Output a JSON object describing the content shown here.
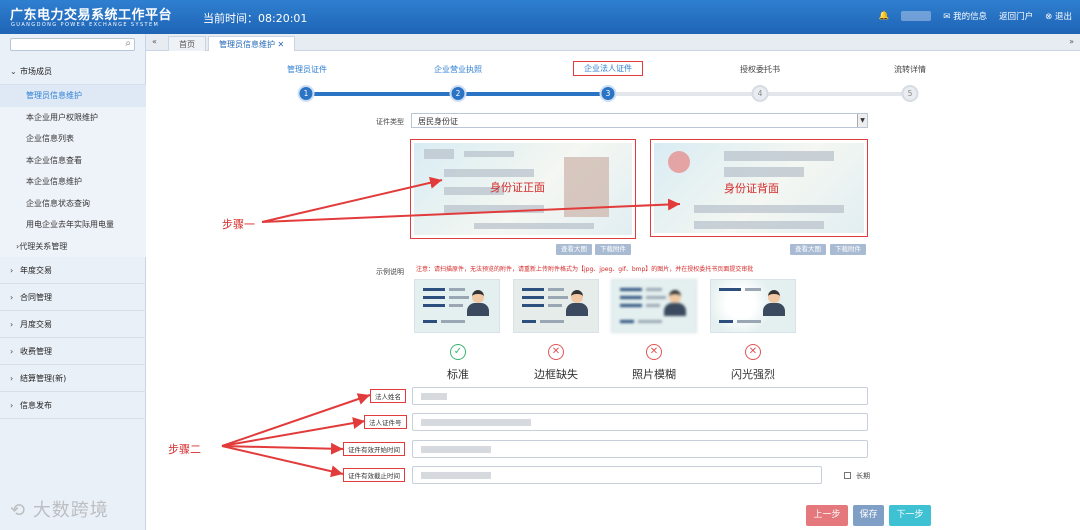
{
  "header": {
    "title_cn": "广东电力交易系统工作平台",
    "title_en": "GUANGDONG POWER EXCHANGE SYSTEM",
    "clock": "当前时间：08:20:01",
    "my_info": "我的信息",
    "return_portal": "返回门户",
    "logout": "退出"
  },
  "tabs": [
    {
      "label": "首页"
    },
    {
      "label": "管理员信息维护"
    }
  ],
  "sidebar": {
    "groups": [
      {
        "label": "市场成员"
      },
      {
        "label": "年度交易"
      },
      {
        "label": "合同管理"
      },
      {
        "label": "月度交易"
      },
      {
        "label": "收费管理"
      },
      {
        "label": "结算管理(新)"
      },
      {
        "label": "信息发布"
      }
    ],
    "subitems": [
      {
        "label": "管理员信息维护"
      },
      {
        "label": "本企业用户权限维护"
      },
      {
        "label": "企业信息列表"
      },
      {
        "label": "本企业信息查看"
      },
      {
        "label": "本企业信息维护"
      },
      {
        "label": "企业信息状态查询"
      },
      {
        "label": "用电企业去年实际用电量"
      },
      {
        "label": "代理关系管理"
      }
    ]
  },
  "steps": [
    {
      "label": "管理员证件",
      "num": "1"
    },
    {
      "label": "企业营业执照",
      "num": "2"
    },
    {
      "label": "企业法人证件",
      "num": "3"
    },
    {
      "label": "授权委托书",
      "num": "4"
    },
    {
      "label": "流转详情",
      "num": "5"
    }
  ],
  "form": {
    "cert_type_label": "证件类型",
    "cert_type_value": "居民身份证",
    "id_front_caption": "身份证正面",
    "id_back_caption": "身份证背面",
    "view_large": "查看大图",
    "download": "下载附件",
    "example_label": "示例说明",
    "note": "注意：请扫描原件，无法预览的附件，请重新上传附件格式为【jpg、jpeg、gif、bmp】的图片，并在授权委托书页面提交审批",
    "examples": [
      {
        "label": "标准",
        "status": "ok"
      },
      {
        "label": "边框缺失",
        "status": "bad"
      },
      {
        "label": "照片模糊",
        "status": "bad"
      },
      {
        "label": "闪光强烈",
        "status": "bad"
      }
    ],
    "fields": [
      {
        "label": "法人姓名"
      },
      {
        "label": "法人证件号"
      },
      {
        "label": "证件有效开始时间"
      },
      {
        "label": "证件有效截止时间"
      }
    ],
    "long_term": "长期",
    "prev": "上一步",
    "save": "保存",
    "next": "下一步"
  },
  "annotations": {
    "step1": "步骤一",
    "step2": "步骤二"
  },
  "watermark": "大数跨境",
  "colors": {
    "header_blue": "#1f64b5",
    "accent_red": "#e23b3b",
    "step_blue": "#2a73c5"
  }
}
